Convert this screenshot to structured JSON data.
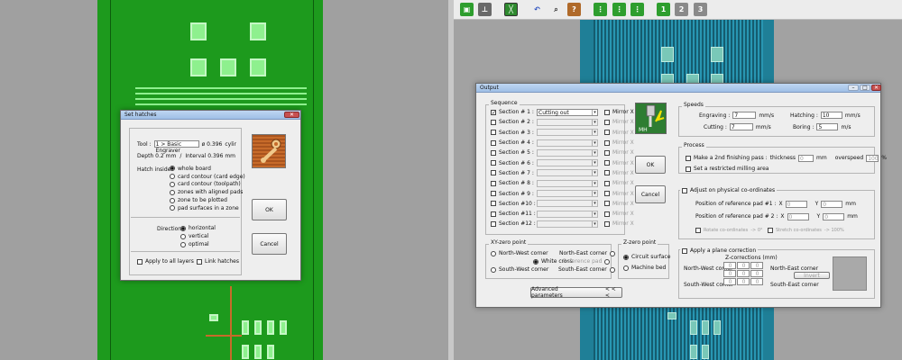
{
  "set_hatches": {
    "title": "Set hatches",
    "tool_label": "Tool :",
    "tool_value": "1 > Basic Engraver",
    "tool_diameter": "ø 0.396",
    "tool_shape": "cylir",
    "depth": "Depth 0.2 mm",
    "interval": "Interval 0.396 mm",
    "hatch_inside_label": "Hatch inside",
    "hatch_inside_options": [
      "whole board",
      "card contour (card edge)",
      "card contour (toolpath)",
      "zones with aligned pads",
      "zone to be plotted",
      "pad surfaces in a zone"
    ],
    "hatch_inside_selected": 0,
    "direction_label": "Direction",
    "direction_options": [
      "horizontal",
      "vertical",
      "optimal"
    ],
    "direction_selected": 0,
    "apply_all_layers": "Apply to all layers",
    "link_hatches": "Link hatches",
    "ok": "OK",
    "cancel": "Cancel"
  },
  "output": {
    "title": "Output",
    "sequence_label": "Sequence",
    "sections": [
      {
        "label": "Section # 1 :",
        "checked": true,
        "value": "Cutting out",
        "mirror": "Mirror X",
        "enabled": true
      },
      {
        "label": "Section # 2 :",
        "checked": false,
        "value": "",
        "mirror": "Mirror X",
        "enabled": false
      },
      {
        "label": "Section # 3 :",
        "checked": false,
        "value": "",
        "mirror": "Mirror X",
        "enabled": false
      },
      {
        "label": "Section # 4 :",
        "checked": false,
        "value": "",
        "mirror": "Mirror X",
        "enabled": false
      },
      {
        "label": "Section # 5 :",
        "checked": false,
        "value": "",
        "mirror": "Mirror X",
        "enabled": false
      },
      {
        "label": "Section # 6 :",
        "checked": false,
        "value": "",
        "mirror": "Mirror X",
        "enabled": false
      },
      {
        "label": "Section # 7 :",
        "checked": false,
        "value": "",
        "mirror": "Mirror X",
        "enabled": false
      },
      {
        "label": "Section # 8 :",
        "checked": false,
        "value": "",
        "mirror": "Mirror X",
        "enabled": false
      },
      {
        "label": "Section # 9 :",
        "checked": false,
        "value": "",
        "mirror": "Mirror X",
        "enabled": false
      },
      {
        "label": "Section #10 :",
        "checked": false,
        "value": "",
        "mirror": "Mirror X",
        "enabled": false
      },
      {
        "label": "Section #11 :",
        "checked": false,
        "value": "",
        "mirror": "Mirror X",
        "enabled": false
      },
      {
        "label": "Section #12 :",
        "checked": false,
        "value": "",
        "mirror": "Mirror X",
        "enabled": false
      }
    ],
    "ok": "OK",
    "cancel": "Cancel",
    "speeds_label": "Speeds",
    "engraving_label": "Engraving :",
    "engraving_value": "7",
    "cutting_label": "Cutting :",
    "cutting_value": "7",
    "hatching_label": "Hatching :",
    "hatching_value": "10",
    "boring_label": "Boring :",
    "boring_value": "5",
    "unit_ms": "mm/s",
    "unit_mms": "m/s",
    "process_label": "Process",
    "second_pass": "Make a 2nd finishing pass :",
    "thickness_label": "thickness",
    "thickness_value": "0",
    "mm": "mm",
    "overspeed_label": "overspeed",
    "overspeed_value": "100",
    "percent": "%",
    "restricted_area": "Set a restricted milling area",
    "adjust_label": "Adjust on physical co-ordinates",
    "ref_pad1": "Position of reference pad #1 :",
    "ref_pad2": "Position of reference pad # 2 :",
    "x_label": "X",
    "y_label": "Y",
    "coord_value": "0",
    "rotate": "Rotate co-ordinates",
    "rotate_value": "-> 0°",
    "stretch": "Stretch co-ordinates",
    "stretch_value": "-> 100%",
    "xy_zero_label": "XY-zero point",
    "nw": "North-West corner",
    "ne": "North-East corner",
    "white_cross": "White cross",
    "ref_pad": "Reference pad",
    "sw": "South-West corner",
    "se": "South-East corner",
    "z_zero_label": "Z-zero point",
    "circuit_surface": "Circuit surface",
    "machine_bed": "Machine bed",
    "plane_correction": "Apply a plane correction",
    "z_corrections": "Z-corrections (mm)",
    "z_nw": "North-West corner",
    "z_ne": "North-East corner",
    "z_sw": "South-West corner",
    "z_se": "South-East corner",
    "z_values": [
      "0",
      "0",
      "0",
      "0",
      "0",
      "0",
      "0",
      "0",
      "0"
    ],
    "invert": "Invert",
    "advanced": "Advanced parameters",
    "advanced_arrows": "< < <"
  },
  "colors": {
    "board_green": "#1d9a1d",
    "pad_green": "#8ef08e",
    "board_blue": "#1f7f97",
    "copper": "#c76b2a"
  }
}
